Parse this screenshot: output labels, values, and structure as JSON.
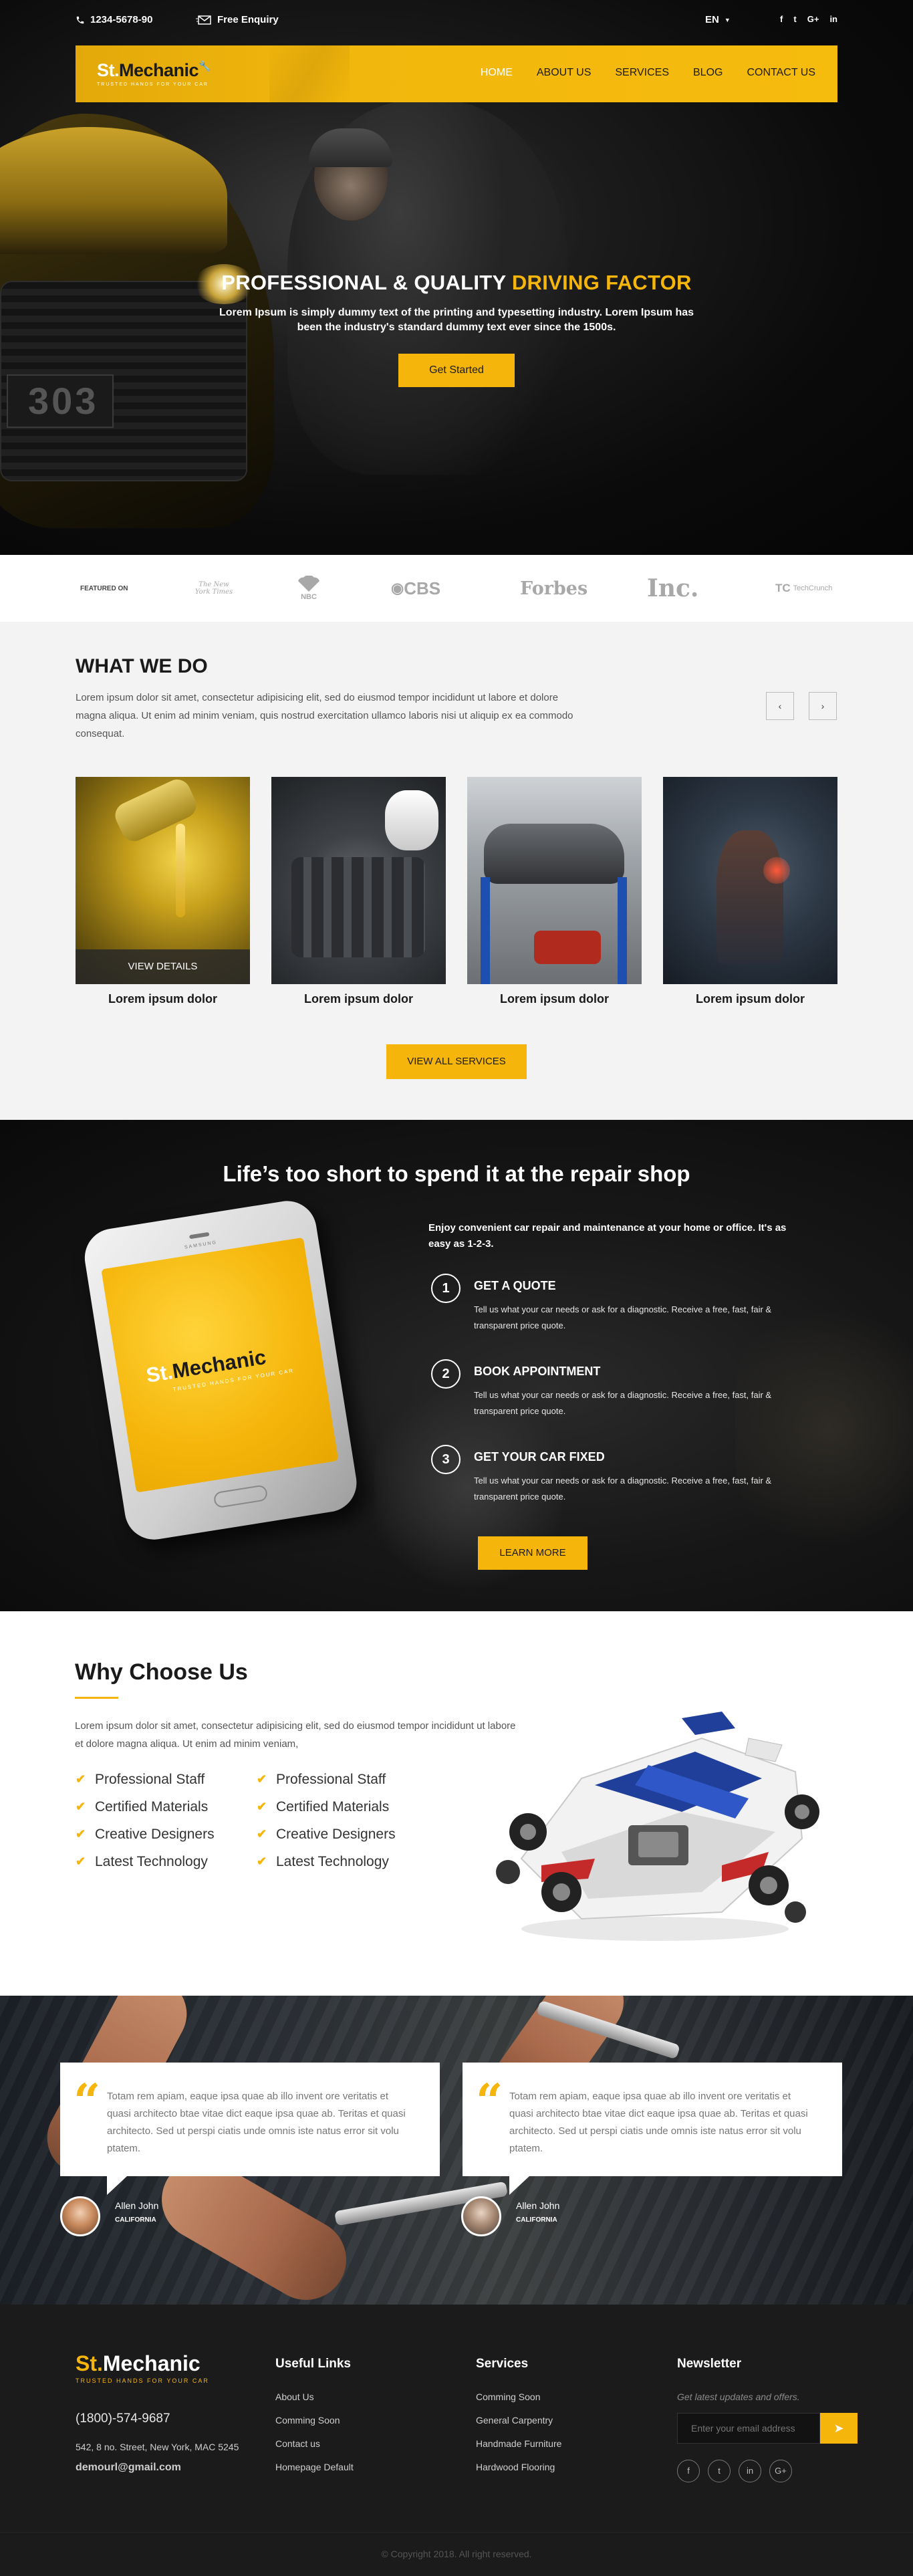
{
  "topbar": {
    "phone": "1234-5678-90",
    "enquiry": "Free Enquiry",
    "language": "EN",
    "social": [
      "f",
      "t",
      "G+",
      "in"
    ]
  },
  "brand": {
    "name_part1": "St.",
    "name_part2": "Mechan",
    "name_part3": "ic",
    "tagline": "TRUSTED HANDS FOR YOUR CAR"
  },
  "nav": {
    "items": [
      "HOME",
      "ABOUT US",
      "SERVICES",
      "BLOG",
      "CONTACT US"
    ],
    "active_index": 0
  },
  "hero": {
    "title_white": "PROFESSIONAL & QUALITY ",
    "title_yellow": "DRIVING FACTOR",
    "subtitle": "Lorem Ipsum is simply dummy text of the printing and typesetting industry. Lorem Ipsum has been the industry's standard dummy text ever since the 1500s.",
    "cta": "Get Started",
    "plate": "303"
  },
  "featured": {
    "label": "FEATURED ON",
    "logos": [
      "The New York Times",
      "NBC",
      "CBS",
      "Forbes",
      "Inc.",
      "TechCrunch"
    ]
  },
  "what_we_do": {
    "title": "WHAT WE DO",
    "text": "Lorem ipsum dolor sit amet, consectetur adipisicing elit, sed do eiusmod tempor incididunt ut labore et dolore magna aliqua. Ut enim ad minim veniam, quis nostrud exercitation ullamco laboris nisi ut aliquip ex ea commodo consequat.",
    "prev": "‹",
    "next": "›",
    "cards": [
      {
        "caption": "Lorem ipsum dolor",
        "overlay": "VIEW DETAILS"
      },
      {
        "caption": "Lorem ipsum dolor"
      },
      {
        "caption": "Lorem ipsum dolor"
      },
      {
        "caption": "Lorem ipsum dolor"
      }
    ],
    "button": "VIEW ALL SERVICES"
  },
  "repair": {
    "title": "Life’s too short to spend it at the repair shop",
    "intro": "Enjoy convenient car repair and maintenance at your home or office. It's as easy as 1-2-3.",
    "phone_brand": "SAMSUNG",
    "steps": [
      {
        "num": "1",
        "title": "GET A QUOTE",
        "text": "Tell us what your car needs or ask for a diagnostic. Receive a free, fast, fair & transparent price quote."
      },
      {
        "num": "2",
        "title": "BOOK APPOINTMENT",
        "text": "Tell us what your car needs or ask for a diagnostic. Receive a free, fast, fair & transparent price quote."
      },
      {
        "num": "3",
        "title": "GET YOUR CAR FIXED",
        "text": "Tell us what your car needs or ask for a diagnostic. Receive a free, fast, fair & transparent price quote."
      }
    ],
    "button": "LEARN MORE"
  },
  "why": {
    "title": "Why Choose Us",
    "text": "Lorem ipsum dolor sit amet, consectetur adipisicing elit, sed do eiusmod tempor incididunt ut labore et dolore magna aliqua. Ut enim ad minim veniam,",
    "col1": [
      "Professional Staff",
      "Certified Materials",
      "Creative Designers",
      "Latest Technology"
    ],
    "col2": [
      "Professional Staff",
      "Certified Materials",
      "Creative Designers",
      "Latest Technology"
    ]
  },
  "testimonials": [
    {
      "text": "Totam rem apiam, eaque ipsa quae ab illo invent ore veritatis et quasi architecto btae vitae dict eaque ipsa quae ab. Teritas et quasi architecto. Sed ut perspi ciatis unde omnis iste natus error sit volu ptatem.",
      "name": "Allen John",
      "location": "CALIFORNIA"
    },
    {
      "text": "Totam rem apiam, eaque ipsa quae ab illo invent ore veritatis et quasi architecto btae vitae dict eaque ipsa quae ab. Teritas et quasi architecto. Sed ut perspi ciatis unde omnis iste natus error sit volu ptatem.",
      "name": "Allen John",
      "location": "CALIFORNIA"
    }
  ],
  "footer": {
    "phone": "(1800)-574-9687",
    "address": "542, 8 no. Street, New York, MAC 5245",
    "email": "demourl@gmail.com",
    "useful_title": "Useful Links",
    "useful_links": [
      "About Us",
      "Comming Soon",
      "Contact us",
      "Homepage Default"
    ],
    "services_title": "Services",
    "services_links": [
      "Comming Soon",
      "General Carpentry",
      "Handmade Furniture",
      "Hardwood Flooring"
    ],
    "newsletter_title": "Newsletter",
    "newsletter_sub": "Get latest updates and offers.",
    "newsletter_placeholder": "Enter your email address",
    "social": [
      "f",
      "t",
      "in",
      "G+"
    ],
    "copyright": "© Copyright 2018. All right reserved."
  }
}
